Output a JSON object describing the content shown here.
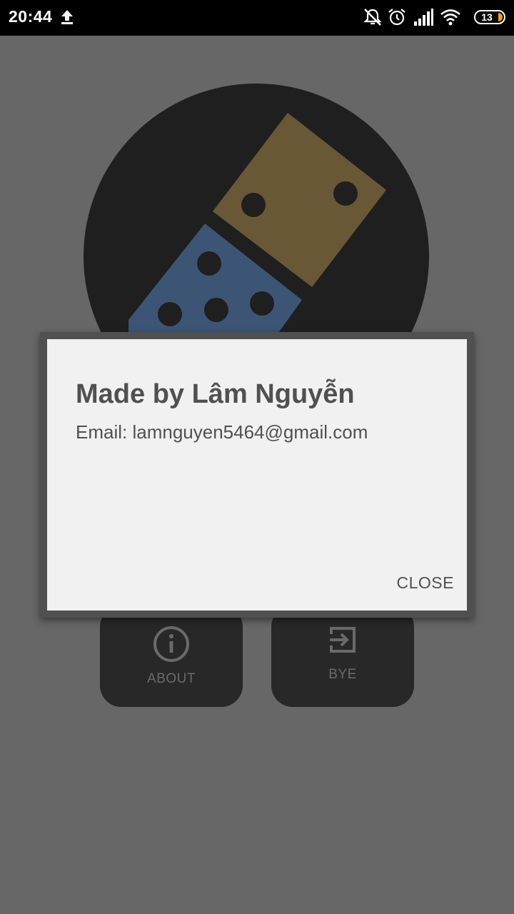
{
  "status_bar": {
    "time": "20:44",
    "battery_level": "13",
    "icons": [
      "upload-icon",
      "mute-icon",
      "alarm-icon",
      "signal-icon",
      "wifi-icon",
      "battery-icon"
    ]
  },
  "app": {
    "logo": {
      "top_tile_color": "#685835",
      "bottom_tile_color": "#3c5574",
      "pip_color": "#1f1f1f"
    },
    "buttons": [
      {
        "label": "ABOUT",
        "icon": "info-icon"
      },
      {
        "label": "BYE",
        "icon": "exit-icon"
      }
    ]
  },
  "dialog": {
    "title": "Made by Lâm Nguyễn",
    "message": "Email: lamnguyen5464@gmail.com",
    "close_label": "CLOSE"
  }
}
